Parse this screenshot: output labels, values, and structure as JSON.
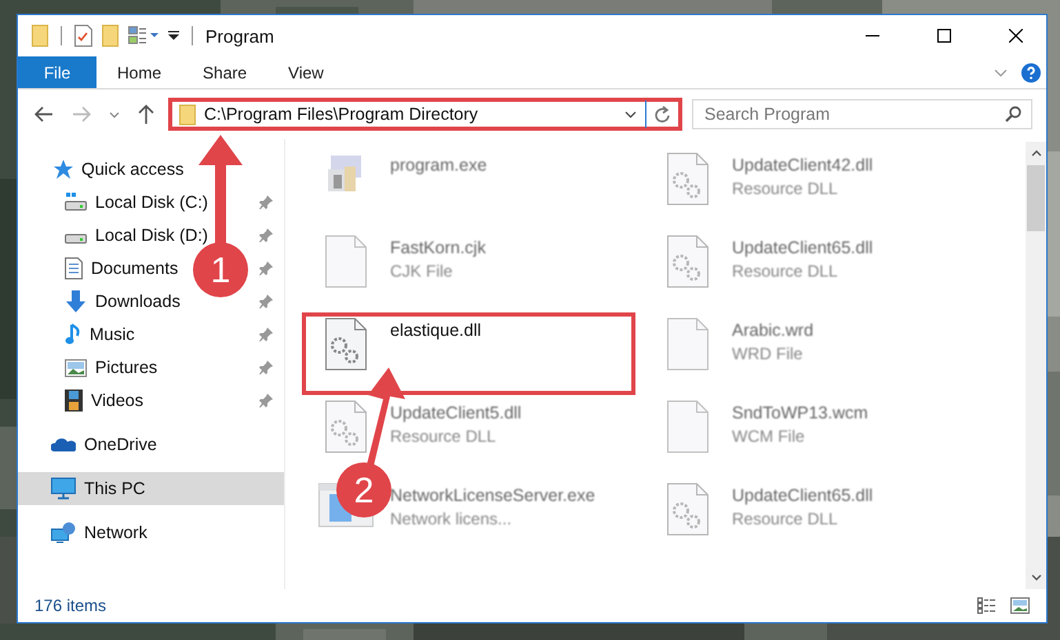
{
  "window": {
    "title": "Program"
  },
  "ribbon": {
    "tabs": [
      {
        "label": "File",
        "kind": "file"
      },
      {
        "label": "Home",
        "kind": "tab"
      },
      {
        "label": "Share",
        "kind": "tab"
      },
      {
        "label": "View",
        "kind": "tab"
      }
    ]
  },
  "address": {
    "path": "C:\\Program Files\\Program Directory",
    "highlighted": true
  },
  "search": {
    "placeholder": "Search Program"
  },
  "nav": [
    {
      "label": "Quick access",
      "kind": "star",
      "selected": false,
      "children": [
        {
          "label": "Local Disk (C:)",
          "kind": "drive-c",
          "pinned": true
        },
        {
          "label": "Local Disk (D:)",
          "kind": "drive",
          "pinned": true
        },
        {
          "label": "Documents",
          "kind": "docs",
          "pinned": true
        },
        {
          "label": "Downloads",
          "kind": "down",
          "pinned": true
        },
        {
          "label": "Music",
          "kind": "music",
          "pinned": true
        },
        {
          "label": "Pictures",
          "kind": "pics",
          "pinned": true
        },
        {
          "label": "Videos",
          "kind": "video",
          "pinned": true
        }
      ]
    },
    {
      "label": "OneDrive",
      "kind": "cloud",
      "selected": false
    },
    {
      "label": "This PC",
      "kind": "pc",
      "selected": true
    },
    {
      "label": "Network",
      "kind": "network",
      "selected": false
    }
  ],
  "files": [
    {
      "name": "program.exe",
      "kind": "exe",
      "blurred": true,
      "highlighted": false
    },
    {
      "name": "UpdateClient42.dll",
      "type": "Resource DLL",
      "kind": "dll",
      "blurred": true,
      "highlighted": false
    },
    {
      "name": "FastKorn.cjk",
      "type": "CJK File",
      "kind": "file",
      "blurred": true,
      "highlighted": false
    },
    {
      "name": "UpdateClient65.dll",
      "type": "Resource DLL",
      "kind": "dll",
      "blurred": true,
      "highlighted": false
    },
    {
      "name": "elastique.dll",
      "kind": "dll",
      "blurred": false,
      "highlighted": true
    },
    {
      "name": "Arabic.wrd",
      "type": "WRD File",
      "kind": "file",
      "blurred": true,
      "highlighted": false
    },
    {
      "name": "UpdateClient5.dll",
      "type": "Resource DLL",
      "kind": "dll",
      "blurred": true,
      "highlighted": false
    },
    {
      "name": "SndToWP13.wcm",
      "type": "WCM File",
      "kind": "file",
      "blurred": true,
      "highlighted": false
    },
    {
      "name": "NetworkLicenseServer.exe",
      "type": "Network licens...",
      "kind": "app",
      "blurred": true,
      "highlighted": false
    },
    {
      "name": "UpdateClient65.dll",
      "type": "Resource DLL",
      "kind": "dll",
      "blurred": true,
      "highlighted": false
    }
  ],
  "status_bar": {
    "count": "176 items"
  },
  "annotations": [
    {
      "number": "1"
    },
    {
      "number": "2"
    }
  ]
}
